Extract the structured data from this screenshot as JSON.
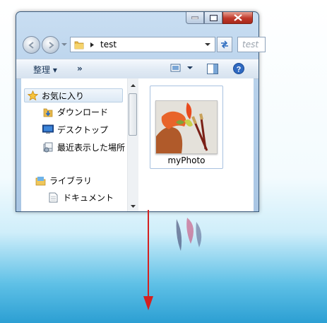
{
  "window": {
    "address_path": "test",
    "search_placeholder": "test"
  },
  "toolbar": {
    "organize_label": "整理 ▾",
    "more_label": "»"
  },
  "nav_pane": {
    "favorites": "お気に入り",
    "items": [
      {
        "label": "ダウンロード",
        "icon": "download-folder-icon"
      },
      {
        "label": "デスクトップ",
        "icon": "desktop-icon"
      },
      {
        "label": "最近表示した場所",
        "icon": "recent-places-icon"
      }
    ],
    "libraries": "ライブラリ",
    "library_items": [
      {
        "label": "ドキュメント",
        "icon": "document-icon"
      }
    ]
  },
  "files": [
    {
      "name": "myPhoto",
      "icon": "image-thumbnail"
    }
  ],
  "colors": {
    "accent_arrow": "#d42020",
    "close_button": "#c0392b",
    "desktop_bottom": "#2c9fd3"
  }
}
